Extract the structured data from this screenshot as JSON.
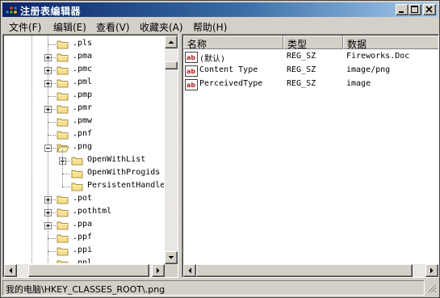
{
  "window": {
    "title": "注册表编辑器"
  },
  "menu": [
    {
      "label": "文件(F)"
    },
    {
      "label": "编辑(E)"
    },
    {
      "label": "查看(V)"
    },
    {
      "label": "收藏夹(A)"
    },
    {
      "label": "帮助(H)"
    }
  ],
  "tree": {
    "items": [
      {
        "label": ".pls",
        "expandable": false,
        "level": 0
      },
      {
        "label": ".pma",
        "expandable": true,
        "level": 0
      },
      {
        "label": ".pmc",
        "expandable": true,
        "level": 0
      },
      {
        "label": ".pml",
        "expandable": true,
        "level": 0
      },
      {
        "label": ".pmp",
        "expandable": false,
        "level": 0
      },
      {
        "label": ".pmr",
        "expandable": true,
        "level": 0
      },
      {
        "label": ".pmw",
        "expandable": false,
        "level": 0
      },
      {
        "label": ".pnf",
        "expandable": false,
        "level": 0
      },
      {
        "label": ".png",
        "expandable": true,
        "expanded": true,
        "open": true,
        "level": 0
      },
      {
        "label": "OpenWithList",
        "expandable": true,
        "level": 1
      },
      {
        "label": "OpenWithProgids",
        "expandable": false,
        "level": 1
      },
      {
        "label": "PersistentHandle",
        "expandable": false,
        "level": 1
      },
      {
        "label": ".pot",
        "expandable": true,
        "level": 0
      },
      {
        "label": ".pothtml",
        "expandable": true,
        "level": 0
      },
      {
        "label": ".ppa",
        "expandable": true,
        "level": 0
      },
      {
        "label": ".ppf",
        "expandable": false,
        "level": 0
      },
      {
        "label": ".ppi",
        "expandable": false,
        "level": 0
      },
      {
        "label": ".ppl",
        "expandable": false,
        "level": 0
      }
    ]
  },
  "list": {
    "columns": [
      "名称",
      "类型",
      "数据"
    ],
    "rows": [
      {
        "name": "(默认)",
        "type": "REG_SZ",
        "data": "Fireworks.Doc"
      },
      {
        "name": "Content Type",
        "type": "REG_SZ",
        "data": "image/png"
      },
      {
        "name": "PerceivedType",
        "type": "REG_SZ",
        "data": "image"
      }
    ]
  },
  "status": {
    "path": "我的电脑\\HKEY_CLASSES_ROOT\\.png"
  },
  "colors": {
    "titlebar_start": "#0a246a",
    "titlebar_end": "#a6caf0",
    "face": "#d4d0c8",
    "folder": "#f8e08c",
    "reg_icon": "#b22222"
  }
}
